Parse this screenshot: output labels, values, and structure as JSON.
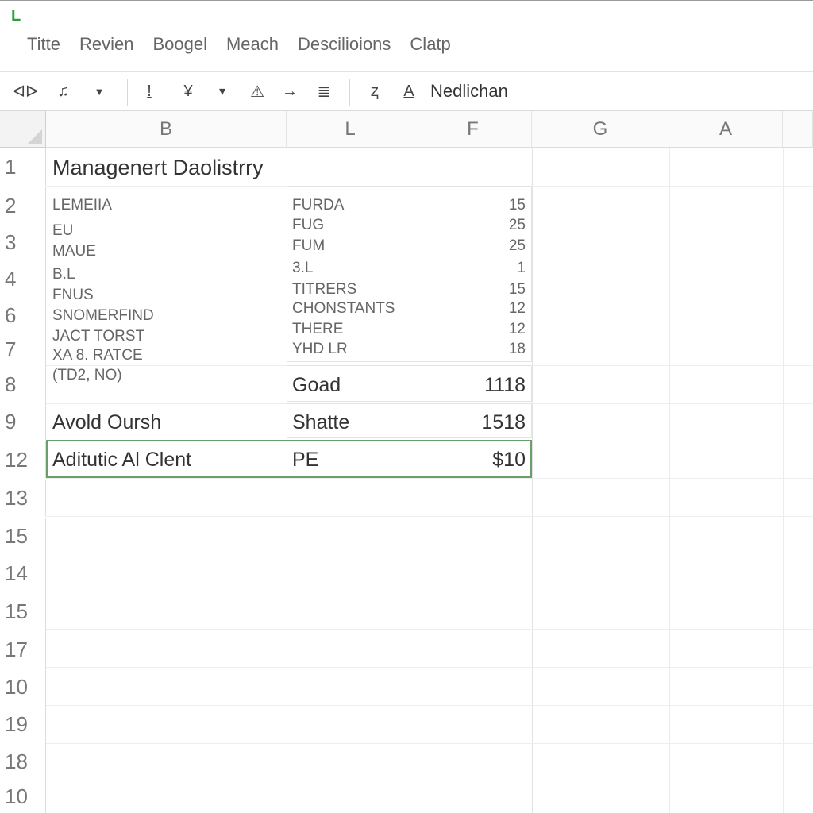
{
  "app": {
    "logo": "L"
  },
  "menu": [
    "Titte",
    "Revien",
    "Boogel",
    "Meach",
    "Descilioions",
    "Clatp"
  ],
  "toolbar": {
    "buttons": [
      {
        "glyph": "ᐊᐅ",
        "icon": "undo-redo-icon"
      },
      {
        "glyph": "♫",
        "icon": "format-painter-icon"
      },
      {
        "glyph": "▼",
        "icon": "dropdown-icon"
      },
      {
        "glyph": "!",
        "icon": "bold-icon"
      },
      {
        "glyph": "¥",
        "icon": "filter-icon"
      },
      {
        "glyph": "▾",
        "icon": "chevron-down-icon"
      },
      {
        "glyph": "⚠",
        "icon": "warning-icon"
      },
      {
        "glyph": "→",
        "icon": "arrow-right-icon"
      },
      {
        "glyph": "≣",
        "icon": "align-icon"
      },
      {
        "glyph": "ⱬ",
        "icon": "text-format-icon"
      },
      {
        "glyph": "A",
        "icon": "font-color-icon"
      }
    ],
    "font_name": "Nedlichan"
  },
  "sheet": {
    "columns": [
      "B",
      "L",
      "F",
      "G",
      "A"
    ],
    "rows": [
      "1",
      "2",
      "3",
      "4",
      "6",
      "7",
      "8",
      "9",
      "12",
      "13",
      "15",
      "14",
      "15",
      "17",
      "10",
      "19",
      "18",
      "10"
    ],
    "title": "Managenert Daolistrry",
    "left_list": [
      "LEMEIIA",
      "EU",
      "MAUE",
      "B.L",
      "FNUS",
      "SNOMERFIND",
      "JACT TORST",
      "XA 8. RATCE",
      "(TD2, NO)"
    ],
    "right_list": [
      {
        "label": "FURDA",
        "value": "15"
      },
      {
        "label": "FUG",
        "value": "25"
      },
      {
        "label": "FUM",
        "value": "25"
      },
      {
        "label": "3.L",
        "value": "1"
      },
      {
        "label": "TITRERS",
        "value": "15"
      },
      {
        "label": "CHONSTANTS",
        "value": "12"
      },
      {
        "label": "THERE",
        "value": "12"
      },
      {
        "label": "YHD LR",
        "value": "18"
      }
    ],
    "row8": {
      "label": "Goad",
      "value": "1118"
    },
    "row9": {
      "left": "Avold Oursh",
      "label": "Shatte",
      "value": "1518"
    },
    "row12": {
      "left": "Aditutic Al Clent",
      "label": "PE",
      "value": "$10"
    }
  },
  "colors": {
    "selection_border": "#6a9e6a",
    "logo": "#2e9e3c"
  }
}
